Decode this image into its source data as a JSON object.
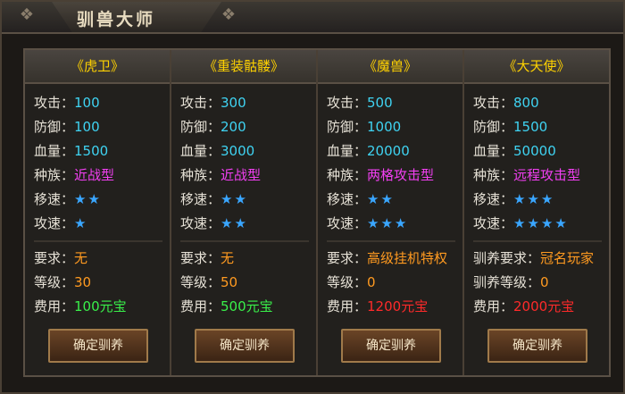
{
  "window": {
    "title": "驯兽大师"
  },
  "columns": [
    {
      "name": "《虎卫》",
      "attack": {
        "label": "攻击：",
        "value": "100"
      },
      "defense": {
        "label": "防御：",
        "value": "100"
      },
      "hp": {
        "label": "血量：",
        "value": "1500"
      },
      "race": {
        "label": "种族：",
        "value": "近战型"
      },
      "move": {
        "label": "移速：",
        "value": "★★"
      },
      "atkspd": {
        "label": "攻速：",
        "value": "★"
      },
      "req": {
        "label": "要求：",
        "value": "无"
      },
      "level": {
        "label": "等级：",
        "value": "30"
      },
      "cost": {
        "label": "费用：",
        "value": "100元宝"
      },
      "button": "确定驯养"
    },
    {
      "name": "《重装骷髅》",
      "attack": {
        "label": "攻击：",
        "value": "300"
      },
      "defense": {
        "label": "防御：",
        "value": "200"
      },
      "hp": {
        "label": "血量：",
        "value": "3000"
      },
      "race": {
        "label": "种族：",
        "value": "近战型"
      },
      "move": {
        "label": "移速：",
        "value": "★★"
      },
      "atkspd": {
        "label": "攻速：",
        "value": "★★"
      },
      "req": {
        "label": "要求：",
        "value": "无"
      },
      "level": {
        "label": "等级：",
        "value": "50"
      },
      "cost": {
        "label": "费用：",
        "value": "500元宝"
      },
      "button": "确定驯养"
    },
    {
      "name": "《魔兽》",
      "attack": {
        "label": "攻击：",
        "value": "500"
      },
      "defense": {
        "label": "防御：",
        "value": "1000"
      },
      "hp": {
        "label": "血量：",
        "value": "20000"
      },
      "race": {
        "label": "种族：",
        "value": "两格攻击型"
      },
      "move": {
        "label": "移速：",
        "value": "★★"
      },
      "atkspd": {
        "label": "攻速：",
        "value": "★★★"
      },
      "req": {
        "label": "要求：",
        "value": "高级挂机特权"
      },
      "level": {
        "label": "等级：",
        "value": "0"
      },
      "cost": {
        "label": "费用：",
        "value": "1200元宝"
      },
      "button": "确定驯养"
    },
    {
      "name": "《大天使》",
      "attack": {
        "label": "攻击：",
        "value": "800"
      },
      "defense": {
        "label": "防御：",
        "value": "1500"
      },
      "hp": {
        "label": "血量：",
        "value": "50000"
      },
      "race": {
        "label": "种族：",
        "value": "远程攻击型"
      },
      "move": {
        "label": "移速：",
        "value": "★★★"
      },
      "atkspd": {
        "label": "攻速：",
        "value": "★★★★"
      },
      "req": {
        "label": "驯养要求：",
        "value": "冠名玩家"
      },
      "level": {
        "label": "驯养等级：",
        "value": "0"
      },
      "cost": {
        "label": "费用：",
        "value": "2000元宝"
      },
      "button": "确定驯养"
    }
  ],
  "colors": {
    "name": "#ffd200",
    "stat_value": "#3fd3f2",
    "race": "#f23ff2",
    "requirement": "#ff9a20",
    "cost_cheap": "#39f04a",
    "cost_expensive": "#ff2a2a",
    "stars": "#3aa6ff"
  }
}
